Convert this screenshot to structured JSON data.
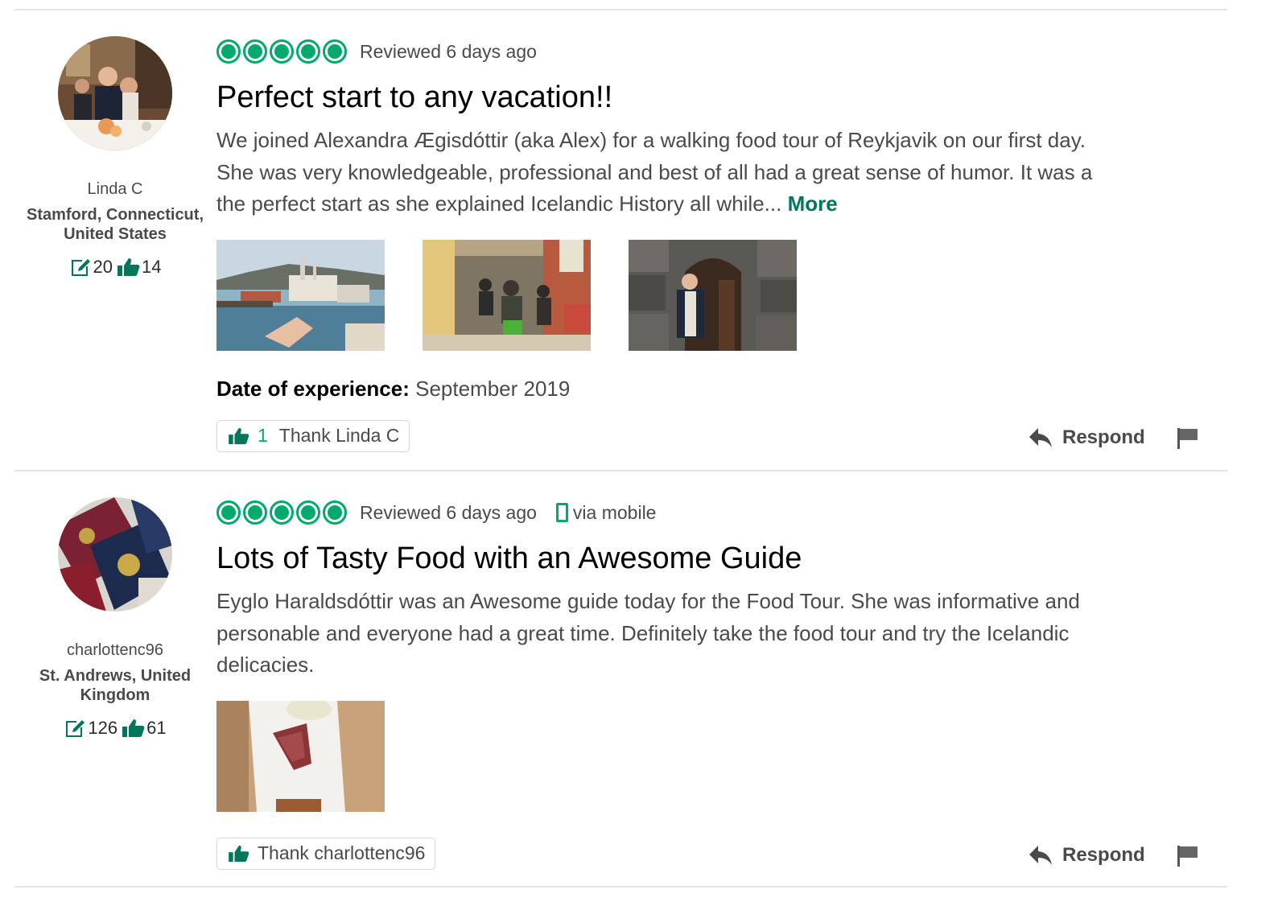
{
  "reviews": [
    {
      "user": {
        "name": "Linda C",
        "location": "Stamford, Connecticut, United States",
        "review_count": "20",
        "helpful_votes": "14"
      },
      "rating_bubbles": 5,
      "reviewed_text": "Reviewed 6 days ago",
      "via_mobile": "",
      "title": "Perfect start to any vacation!!",
      "body": "We joined Alexandra Ægisdóttir (aka Alex) for a walking food tour of Reykjavik on our first day. She was very knowledgeable, professional and best of all had a great sense of humor. It was a the perfect start as she explained Icelandic History all while...",
      "more_label": "More",
      "photos": [
        "harbor-boats-photo",
        "motorcycle-parade-photo",
        "guide-at-door-photo"
      ],
      "date_label": "Date of experience:",
      "date_value": "September 2019",
      "thank_count": "1",
      "thank_label": "Thank Linda C",
      "respond_label": "Respond"
    },
    {
      "user": {
        "name": "charlottenc96",
        "location": "St. Andrews, United Kingdom",
        "review_count": "126",
        "helpful_votes": "61"
      },
      "rating_bubbles": 5,
      "reviewed_text": "Reviewed 6 days ago",
      "via_mobile": "via mobile",
      "title": "Lots of Tasty Food with an Awesome Guide",
      "body": "Eyglo Haraldsdóttir was an Awesome guide today for the Food Tour. She was informative and personable and everyone had a great time. Definitely take the food tour and try the Icelandic delicacies.",
      "photos": [
        "food-plate-photo"
      ],
      "thank_label": "Thank charlottenc96",
      "respond_label": "Respond"
    }
  ],
  "colors": {
    "brand_green": "#00aa6c",
    "more_link": "#00775a",
    "text": "#4a4a4a",
    "divider": "#e3e3e3"
  }
}
